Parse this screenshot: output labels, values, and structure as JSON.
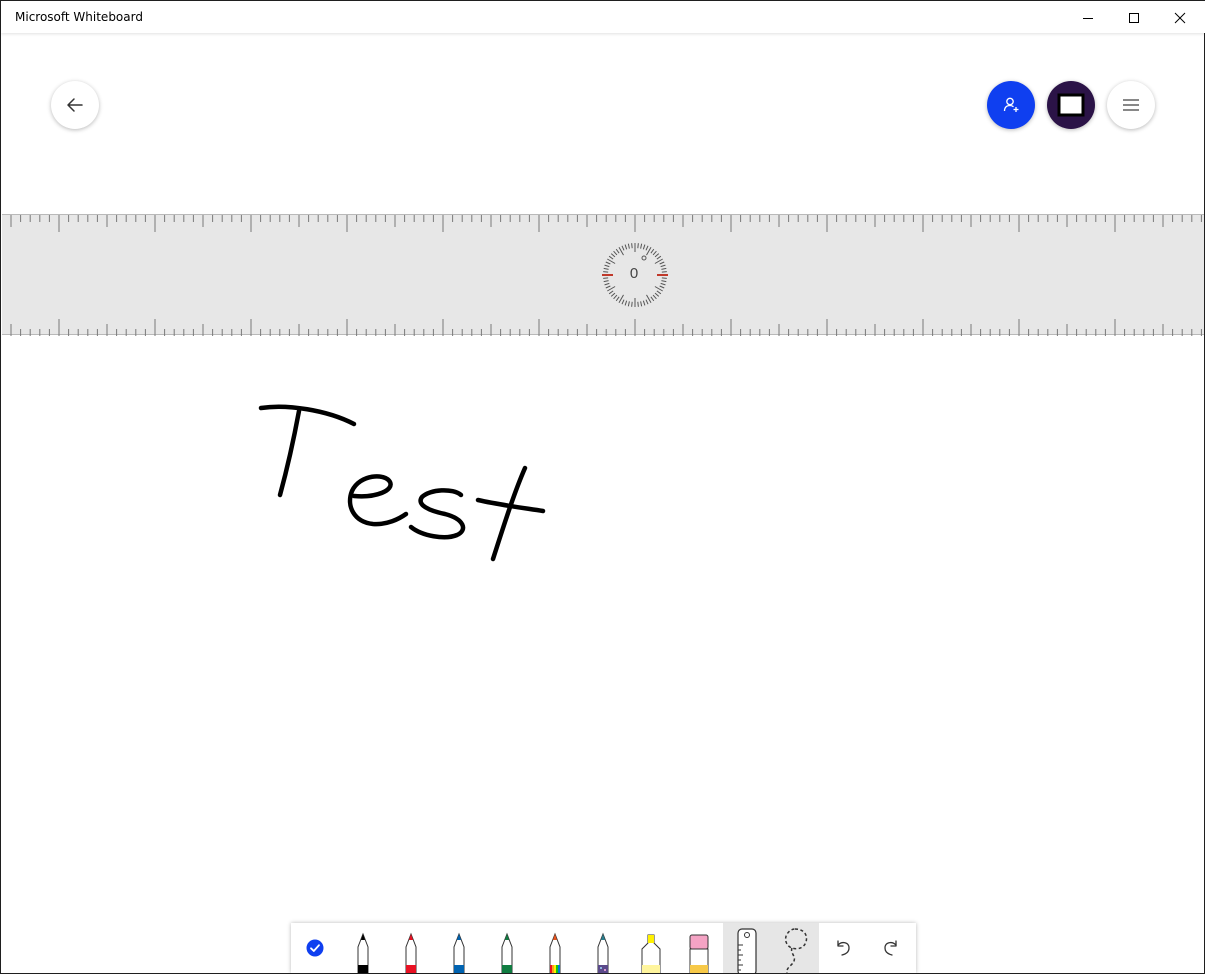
{
  "window": {
    "title": "Microsoft Whiteboard",
    "controls": [
      "minimize-icon",
      "maximize-icon",
      "close-icon"
    ]
  },
  "header": {
    "back_icon": "arrow-left-icon",
    "invite_icon": "add-person-icon",
    "screen_icon": "screen-frame-icon",
    "menu_icon": "hamburger-menu-icon"
  },
  "ruler": {
    "angle": "0"
  },
  "canvas": {
    "ink_text": "Test"
  },
  "toolbar": {
    "tools": [
      {
        "name": "select",
        "icon": "checkmark-circle-icon"
      },
      {
        "name": "pen-black",
        "color": "#000000"
      },
      {
        "name": "pen-red",
        "color": "#e81123"
      },
      {
        "name": "pen-blue",
        "color": "#0063b1"
      },
      {
        "name": "pen-green",
        "color": "#107c41"
      },
      {
        "name": "pen-rainbow",
        "color": "rainbow"
      },
      {
        "name": "pen-galaxy",
        "color": "galaxy"
      },
      {
        "name": "highlighter",
        "color": "#fff100"
      },
      {
        "name": "eraser",
        "color": "#f4a3c4"
      },
      {
        "name": "ruler",
        "icon": "ruler-icon"
      },
      {
        "name": "lasso",
        "icon": "lasso-icon"
      },
      {
        "name": "undo",
        "icon": "undo-icon"
      },
      {
        "name": "redo",
        "icon": "redo-icon"
      }
    ]
  },
  "colors": {
    "accent_blue": "#0f3ff0",
    "screen_purple": "#2b1347",
    "ruler_bg": "#e7e7e7",
    "ruler_marker": "#c0392b"
  }
}
